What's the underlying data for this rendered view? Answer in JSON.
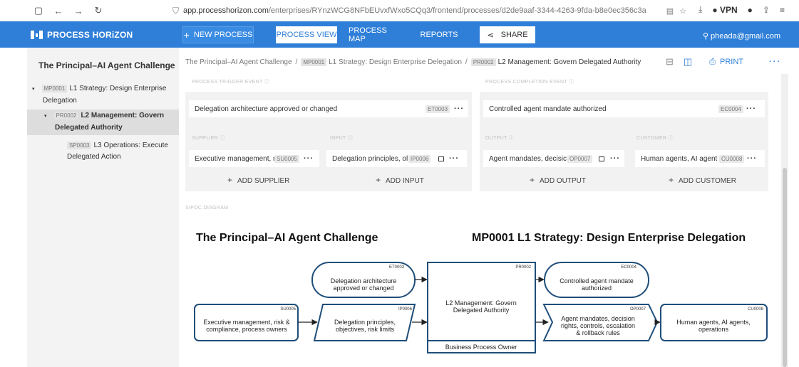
{
  "browser": {
    "url_prefix": "app.processhorizon.com",
    "url_rest": "/enterprises/RYnzWCG8NFbEUvxfWxo5CQq3/frontend/processes/d2de9aaf-3344-4263-9fda-b8e0ec356c3a",
    "vpn_label": "VPN"
  },
  "app": {
    "logo": "PROCESS HORiZON",
    "new_process": "NEW PROCESS",
    "process_view": "PROCESS VIEW",
    "process_map": "PROCESS MAP",
    "reports": "REPORTS",
    "share": "SHARE",
    "user": "pheada@gmail.com"
  },
  "sidebar": {
    "title": "The Principal–AI Agent Challenge",
    "items": [
      {
        "code": "MP0001",
        "text1": "L1 Strategy: Design Enterprise",
        "text2": "Delegation"
      },
      {
        "code": "PR0002",
        "text1": "L2 Management: Govern",
        "text2": "Delegated Authority"
      },
      {
        "code": "SP0003",
        "text1": "L3 Operations: Execute",
        "text2": "Delegated Action"
      }
    ]
  },
  "breadcrumb": {
    "root": "The Principal–AI Agent Challenge",
    "c1_code": "MP0001",
    "c1_text": "L1 Strategy: Design Enterprise Delegation",
    "c2_code": "PR0002",
    "c2_text": "L2 Management: Govern Delegated Authority",
    "print": "PRINT"
  },
  "sipoc": {
    "trigger_label": "PROCESS TRIGGER EVENT",
    "completion_label": "PROCESS COMPLETION EVENT",
    "supplier_label": "SUPPLIER",
    "input_label": "INPUT",
    "output_label": "OUTPUT",
    "customer_label": "CUSTOMER",
    "trigger": {
      "text": "Delegation architecture approved or changed",
      "code": "ET0003"
    },
    "completion": {
      "text": "Controlled agent mandate authorized",
      "code": "EC0004"
    },
    "supplier": {
      "text": "Executive management, r",
      "code": "SU0005"
    },
    "input": {
      "text": "Delegation principles, ol",
      "code": "IP0006"
    },
    "output": {
      "text": "Agent mandates, decisic",
      "code": "OP0007"
    },
    "customer": {
      "text": "Human agents, AI agent",
      "code": "CU0008"
    },
    "add_supplier": "ADD SUPPLIER",
    "add_input": "ADD INPUT",
    "add_output": "ADD OUTPUT",
    "add_customer": "ADD CUSTOMER",
    "diagram_label": "SIPOC DIAGRAM"
  },
  "diagram": {
    "title_left": "The Principal–AI Agent Challenge",
    "title_right": "MP0001 L1 Strategy: Design Enterprise Delegation",
    "trigger": {
      "code": "ET0003",
      "line1": "Delegation architecture",
      "line2": "approved or changed"
    },
    "process": {
      "code": "PR0002",
      "line1": "L2 Management: Govern",
      "line2": "Delegated Authority",
      "owner": "Business Process Owner"
    },
    "completion": {
      "code": "EC0004",
      "line1": "Controlled agent mandate",
      "line2": "authorized"
    },
    "supplier": {
      "code": "SU0005",
      "line1": "Executive management, risk &",
      "line2": "compliance, process owners"
    },
    "input": {
      "code": "IP0006",
      "line1": "Delegation principles,",
      "line2": "objectives, risk limits"
    },
    "output": {
      "code": "OP0007",
      "line1": "Agent mandates, decision",
      "line2": "rights, controls, escalation",
      "line3": "& rollback rules"
    },
    "customer": {
      "code": "CU0008",
      "line1": "Human agents, AI agents,",
      "line2": "operations"
    }
  },
  "colors": {
    "brand": "#2f7fd8",
    "diagram_stroke": "#1f4e79"
  }
}
